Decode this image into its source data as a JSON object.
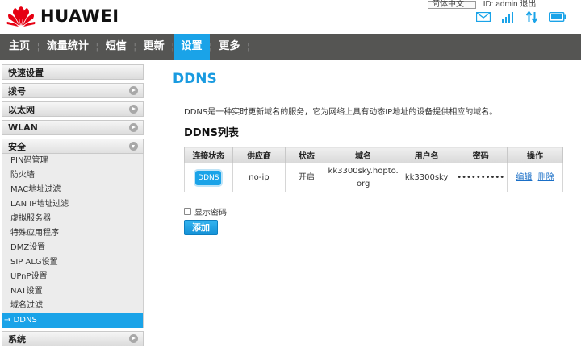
{
  "header": {
    "brand": "HUAWEI",
    "language": "简体中文",
    "topbar_rest": "ID: admin  退出"
  },
  "nav": {
    "items": [
      {
        "label": "主页"
      },
      {
        "label": "流量统计"
      },
      {
        "label": "短信"
      },
      {
        "label": "更新"
      },
      {
        "label": "设置",
        "active": true
      },
      {
        "label": "更多"
      }
    ]
  },
  "sidebar": {
    "quick": "快速设置",
    "dial": "拨号",
    "ethernet": "以太网",
    "wlan": "WLAN",
    "security": "安全",
    "security_items": [
      "PIN码管理",
      "防火墙",
      "MAC地址过滤",
      "LAN IP地址过滤",
      "虚拟服务器",
      "特殊应用程序",
      "DMZ设置",
      "SIP ALG设置",
      "UPnP设置",
      "NAT设置",
      "域名过滤",
      "→ DDNS"
    ],
    "system": "系统"
  },
  "main": {
    "title": "DDNS",
    "description": "DDNS是一种实时更新域名的服务，它为网络上具有动态IP地址的设备提供相应的域名。",
    "list_title": "DDNS列表",
    "table": {
      "headers": [
        "连接状态",
        "供应商",
        "状态",
        "域名",
        "用户名",
        "密码",
        "操作"
      ],
      "row": {
        "conn": "DDNS",
        "provider": "no-ip",
        "status": "开启",
        "domain_1": "kk3300sky.hopto.",
        "domain_2": "org",
        "username": "kk3300sky",
        "password": "••••••••••",
        "edit": "编辑",
        "delete": "删除"
      }
    },
    "show_password": "显示密码",
    "add_button": "添加"
  },
  "colors": {
    "accent": "#1aa3e8",
    "nav_bg": "#555553",
    "title": "#1a9be0"
  }
}
